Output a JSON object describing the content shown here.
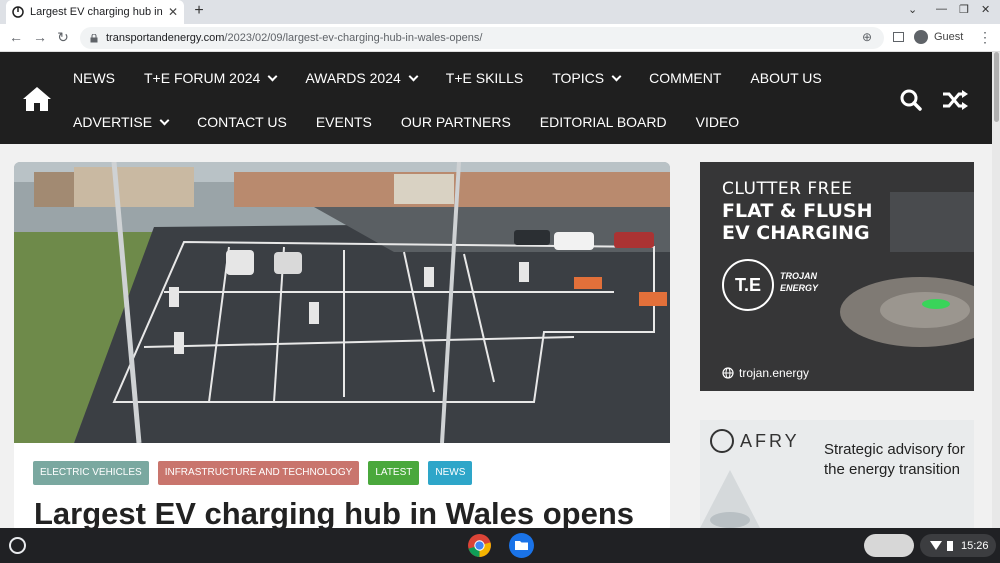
{
  "browser": {
    "tab_title": "Largest EV charging hub in Wales opens",
    "url_host": "transportandenergy.com",
    "url_path": "/2023/02/09/largest-ev-charging-hub-in-wales-opens/",
    "profile_label": "Guest",
    "new_tab_symbol": "+",
    "close_symbol": "✕"
  },
  "site_nav": {
    "row1": [
      {
        "label": "NEWS",
        "dropdown": false
      },
      {
        "label": "T+E FORUM 2024",
        "dropdown": true
      },
      {
        "label": "AWARDS 2024",
        "dropdown": true
      },
      {
        "label": "T+E SKILLS",
        "dropdown": false
      },
      {
        "label": "TOPICS",
        "dropdown": true
      },
      {
        "label": "COMMENT",
        "dropdown": false
      },
      {
        "label": "ABOUT US",
        "dropdown": false
      }
    ],
    "row2": [
      {
        "label": "ADVERTISE",
        "dropdown": true
      },
      {
        "label": "CONTACT US",
        "dropdown": false
      },
      {
        "label": "EVENTS",
        "dropdown": false
      },
      {
        "label": "OUR PARTNERS",
        "dropdown": false
      },
      {
        "label": "EDITORIAL BOARD",
        "dropdown": false
      },
      {
        "label": "VIDEO",
        "dropdown": false
      }
    ],
    "background": "#1f1f1f"
  },
  "article": {
    "tags": [
      {
        "label": "ELECTRIC VEHICLES",
        "color": "#7aa8a0"
      },
      {
        "label": "INFRASTRUCTURE AND TECHNOLOGY",
        "color": "#c9756d"
      },
      {
        "label": "LATEST",
        "color": "#4aa83c"
      },
      {
        "label": "NEWS",
        "color": "#2ea6c9"
      }
    ],
    "headline": "Largest EV charging hub in Wales opens"
  },
  "ads": {
    "trojan": {
      "line1": "CLUTTER FREE",
      "line2": "FLAT & FLUSH",
      "line3": "EV CHARGING",
      "logo_text": "T.E",
      "brand_line1": "TROJAN",
      "brand_line2": "ENERGY",
      "url": "trojan.energy"
    },
    "afry": {
      "logo": "AFRY",
      "text": "Strategic advisory for the energy transition"
    }
  },
  "shelf": {
    "time": "15:26"
  }
}
